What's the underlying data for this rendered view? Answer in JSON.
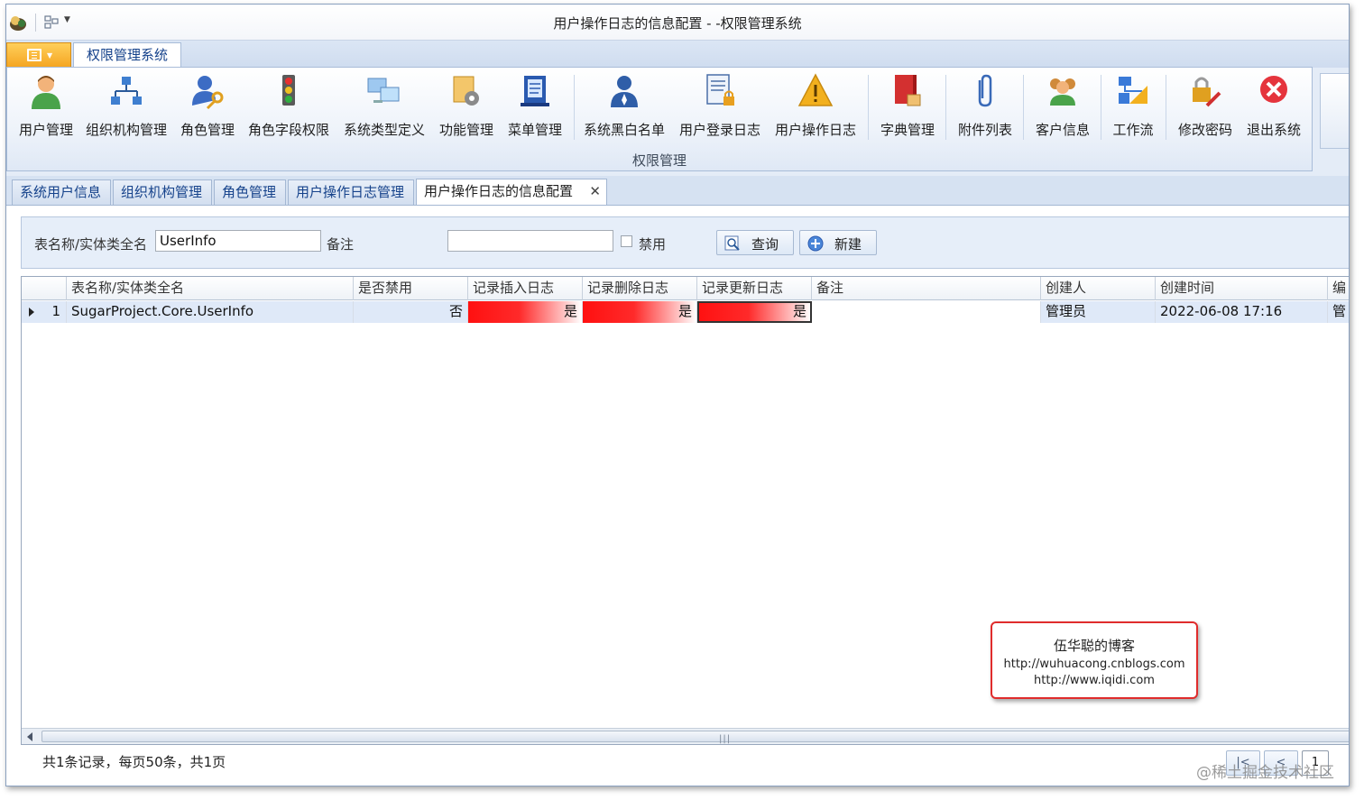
{
  "window": {
    "title": "用户操作日志的信息配置 - -权限管理系统"
  },
  "ribbon": {
    "tab": "权限管理系统",
    "group_label": "权限管理",
    "buttons": [
      {
        "label": "用户管理",
        "icon": "user-icon"
      },
      {
        "label": "组织机构管理",
        "icon": "org-chart-icon"
      },
      {
        "label": "角色管理",
        "icon": "role-key-icon"
      },
      {
        "label": "角色字段权限",
        "icon": "traffic-light-icon"
      },
      {
        "label": "系统类型定义",
        "icon": "computers-icon"
      },
      {
        "label": "功能管理",
        "icon": "gear-folder-icon"
      },
      {
        "label": "菜单管理",
        "icon": "book-menu-icon"
      },
      {
        "label": "系统黑白名单",
        "icon": "person-blacklist-icon"
      },
      {
        "label": "用户登录日志",
        "icon": "document-lock-icon"
      },
      {
        "label": "用户操作日志",
        "icon": "warning-icon"
      },
      {
        "label": "字典管理",
        "icon": "dictionary-book-icon"
      },
      {
        "label": "附件列表",
        "icon": "paperclip-icon"
      },
      {
        "label": "客户信息",
        "icon": "customers-icon"
      },
      {
        "label": "工作流",
        "icon": "workflow-icon"
      },
      {
        "label": "修改密码",
        "icon": "lock-pen-icon"
      },
      {
        "label": "退出系统",
        "icon": "exit-icon"
      }
    ]
  },
  "doc_tabs": [
    {
      "label": "系统用户信息"
    },
    {
      "label": "组织机构管理"
    },
    {
      "label": "角色管理"
    },
    {
      "label": "用户操作日志管理"
    },
    {
      "label": "用户操作日志的信息配置",
      "active": true
    }
  ],
  "filter": {
    "table_label": "表名称/实体类全名",
    "table_value": "UserInfo",
    "note_label": "备注",
    "note_value": "",
    "disabled_label": "禁用",
    "search_button": "查询",
    "new_button": "新建"
  },
  "grid": {
    "columns": [
      "表名称/实体类全名",
      "是否禁用",
      "记录插入日志",
      "记录删除日志",
      "记录更新日志",
      "备注",
      "创建人",
      "创建时间",
      "编"
    ],
    "rows": [
      {
        "num": "1",
        "name": "SugarProject.Core.UserInfo",
        "disabled": "否",
        "insert_log": "是",
        "delete_log": "是",
        "update_log": "是",
        "note": "",
        "creator": "管理员",
        "created": "2022-06-08 17:16",
        "editor": "管"
      }
    ]
  },
  "watermark": {
    "line1": "伍华聪的博客",
    "line2": "http://wuhuacong.cnblogs.com",
    "line3": "http://www.iqidi.com"
  },
  "footer": {
    "summary": "共1条记录，每页50条，共1页",
    "first_page": "|<",
    "prev_page": "<",
    "page_number": "1"
  },
  "corner_watermark": "@稀土掘金技术社区",
  "colors": {
    "accent_orange": "#f5a623",
    "ribbon_blue": "#15428b",
    "flag_red": "#ff1010"
  }
}
